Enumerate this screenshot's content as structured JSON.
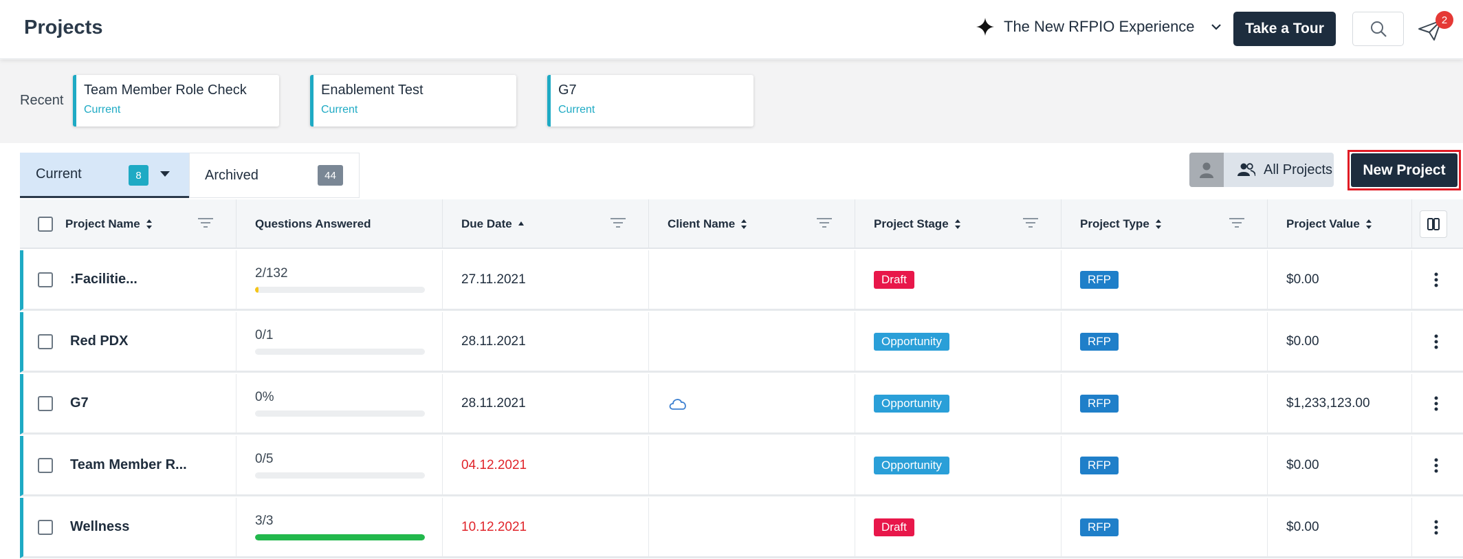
{
  "header": {
    "title": "Projects",
    "experience_label": "The New RFPIO Experience",
    "tour_label": "Take a Tour",
    "notification_count": "2"
  },
  "recent": {
    "label": "Recent",
    "items": [
      {
        "title": "Team Member Role Check",
        "status": "Current"
      },
      {
        "title": "Enablement Test",
        "status": "Current"
      },
      {
        "title": "G7",
        "status": "Current"
      }
    ]
  },
  "tabs": {
    "current_label": "Current",
    "current_count": "8",
    "archived_label": "Archived",
    "archived_count": "44"
  },
  "toolbar": {
    "all_projects_label": "All Projects",
    "new_project_label": "New Project"
  },
  "table": {
    "columns": [
      "Project Name",
      "Questions Answered",
      "Due Date",
      "Client Name",
      "Project Stage",
      "Project Type",
      "Project Value"
    ],
    "rows": [
      {
        "name": ":Facilitie...",
        "answered": "2/132",
        "progress": 0.015,
        "due": "27.11.2021",
        "due_overdue": false,
        "client": "",
        "stage": "Draft",
        "type": "RFP",
        "value": "$0.00"
      },
      {
        "name": "Red PDX",
        "answered": "0/1",
        "progress": 0,
        "due": "28.11.2021",
        "due_overdue": false,
        "client": "",
        "stage": "Opportunity",
        "type": "RFP",
        "value": "$0.00"
      },
      {
        "name": "G7",
        "answered": "0%",
        "progress": 0,
        "due": "28.11.2021",
        "due_overdue": false,
        "client": "cloud-icon",
        "stage": "Opportunity",
        "type": "RFP",
        "value": "$1,233,123.00"
      },
      {
        "name": "Team Member R...",
        "answered": "0/5",
        "progress": 0,
        "due": "04.12.2021",
        "due_overdue": true,
        "client": "",
        "stage": "Opportunity",
        "type": "RFP",
        "value": "$0.00"
      },
      {
        "name": "Wellness",
        "answered": "3/3",
        "progress": 1,
        "due": "10.12.2021",
        "due_overdue": true,
        "client": "",
        "stage": "Draft",
        "type": "RFP",
        "value": "$0.00"
      }
    ]
  },
  "colors": {
    "primary_dark": "#1d2d3e",
    "accent_teal": "#1eaac4",
    "draft_red": "#e8174a",
    "opportunity_blue": "#2a9fd8",
    "rfp_blue": "#1f7fc9",
    "progress_green": "#22b84c",
    "progress_yellow": "#f5c518",
    "overdue_red": "#e0242a",
    "highlight_red": "#e01b24"
  }
}
